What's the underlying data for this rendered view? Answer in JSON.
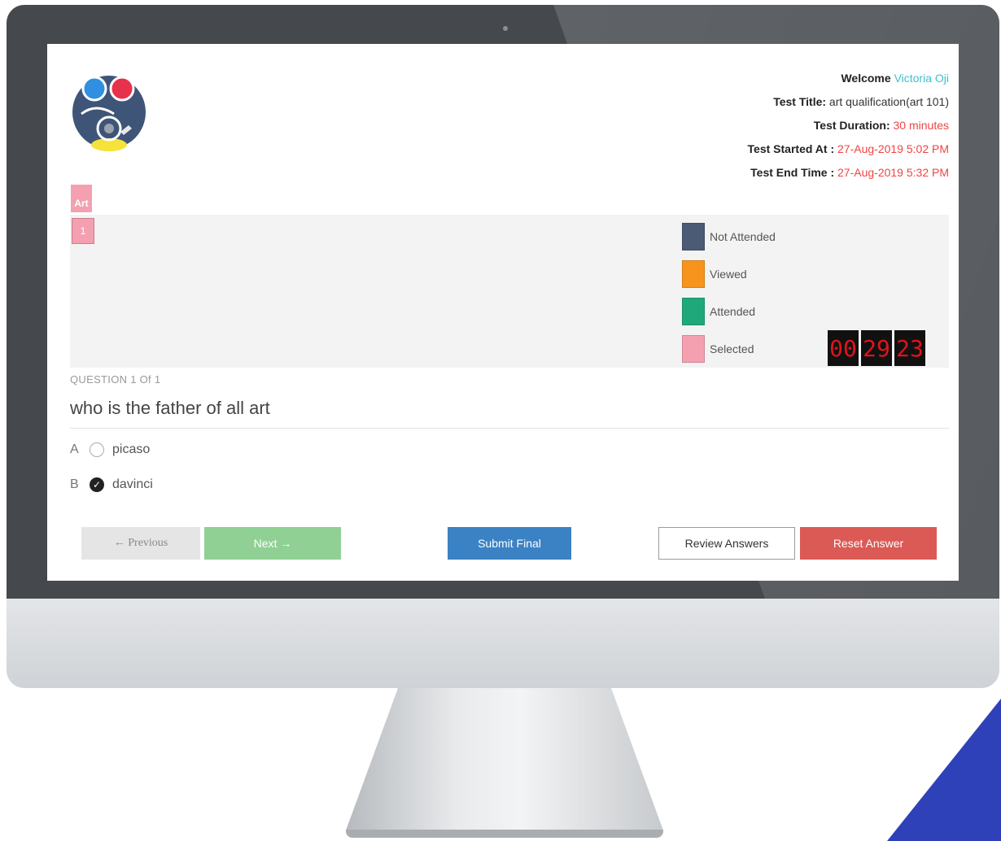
{
  "header": {
    "welcome_label": "Welcome",
    "user_name": "Victoria Oji",
    "test_title_label": "Test Title:",
    "test_title": "art qualification(art 101)",
    "test_duration_label": "Test Duration:",
    "test_duration": "30 minutes",
    "test_started_label": "Test Started At :",
    "test_started": "27-Aug-2019 5:02 PM",
    "test_end_label": "Test End Time :",
    "test_end": "27-Aug-2019 5:32 PM"
  },
  "subject_tab": "Art",
  "question_nav": [
    "1"
  ],
  "legend": [
    {
      "label": "Not Attended",
      "color": "#4b5a75"
    },
    {
      "label": "Viewed",
      "color": "#f7941d"
    },
    {
      "label": "Attended",
      "color": "#1fa97a"
    },
    {
      "label": "Selected",
      "color": "#f4a0b1"
    }
  ],
  "timer": {
    "hours": "00",
    "minutes": "29",
    "seconds": "23"
  },
  "question": {
    "counter": "QUESTION 1 Of 1",
    "text": "who is the father of all art",
    "options": [
      {
        "letter": "A",
        "text": "picaso",
        "selected": false
      },
      {
        "letter": "B",
        "text": "davinci",
        "selected": true
      }
    ]
  },
  "buttons": {
    "previous": "← Previous",
    "next": "Next →",
    "submit": "Submit Final",
    "review": "Review Answers",
    "reset": "Reset Answer"
  }
}
